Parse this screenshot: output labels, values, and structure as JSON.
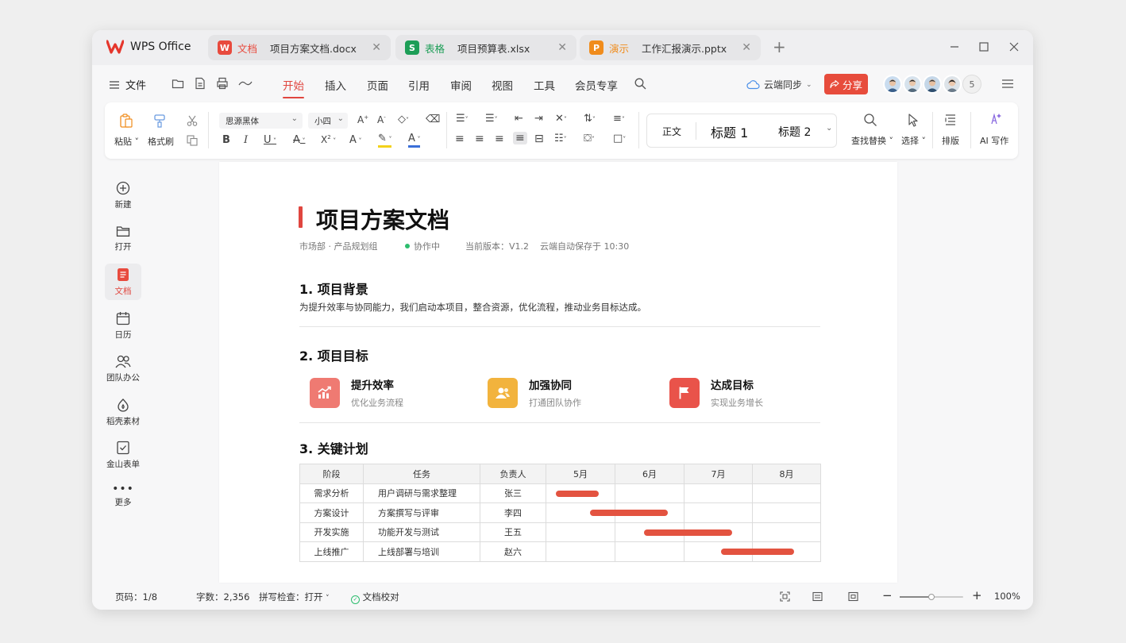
{
  "app": {
    "name": "WPS Office"
  },
  "tabs": [
    {
      "kind": "文档",
      "badge": "W",
      "color": "#e84a3d",
      "file": "项目方案文档.docx",
      "active": true
    },
    {
      "kind": "表格",
      "badge": "S",
      "color": "#1d9e57",
      "file": "项目预算表.xlsx"
    },
    {
      "kind": "演示",
      "badge": "P",
      "color": "#f08c1c",
      "file": "工作汇报演示.pptx"
    }
  ],
  "menu": {
    "file": "文件",
    "tabs": [
      "开始",
      "插入",
      "页面",
      "引用",
      "审阅",
      "视图",
      "工具",
      "会员专享"
    ],
    "active_index": 0,
    "cloud_sync": "云端同步",
    "share": "分享",
    "collaborator_count": "5"
  },
  "ribbon": {
    "paste": "粘贴",
    "format_painter": "格式刷",
    "font": "思源黑体",
    "font_size": "小四",
    "styles": [
      "正文",
      "标题 1",
      "标题 2"
    ],
    "find_replace": "查找替换",
    "select": "选择",
    "layout": "排版",
    "ai_write": "AI 写作"
  },
  "sidebar": [
    {
      "label": "新建",
      "icon": "plus-circle-icon"
    },
    {
      "label": "打开",
      "icon": "folder-icon"
    },
    {
      "label": "文档",
      "icon": "document-icon",
      "active": true
    },
    {
      "label": "日历",
      "icon": "calendar-icon"
    },
    {
      "label": "团队办公",
      "icon": "team-icon"
    },
    {
      "label": "稻壳素材",
      "icon": "material-icon"
    },
    {
      "label": "金山表单",
      "icon": "form-icon"
    },
    {
      "label": "更多",
      "icon": "more-icon"
    }
  ],
  "document": {
    "title": "项目方案文档",
    "dept": "市场部 · 产品规划组",
    "status": "协作中",
    "version": "当前版本：V1.2",
    "autosave": "云端自动保存于 10:30",
    "s1": {
      "title": "1. 项目背景",
      "text": "为提升效率与协同能力，我们启动本项目，整合资源，优化流程，推动业务目标达成。"
    },
    "s2": {
      "title": "2. 项目目标",
      "goals": [
        {
          "title": "提升效率",
          "subtitle": "优化业务流程",
          "color": "#ef7a72",
          "icon": "chart-up-icon"
        },
        {
          "title": "加强协同",
          "subtitle": "打通团队协作",
          "color": "#f2b33d",
          "icon": "people-icon"
        },
        {
          "title": "达成目标",
          "subtitle": "实现业务增长",
          "color": "#e9534a",
          "icon": "flag-icon"
        }
      ]
    },
    "s3": {
      "title": "3. 关键计划",
      "headers": [
        "阶段",
        "任务",
        "负责人",
        "5月",
        "6月",
        "7月",
        "8月"
      ],
      "rows": [
        {
          "stage": "需求分析",
          "task": "用户调研与需求整理",
          "owner": "张三",
          "start": 5.15,
          "end": 5.78
        },
        {
          "stage": "方案设计",
          "task": "方案撰写与评审",
          "owner": "李四",
          "start": 5.65,
          "end": 6.78
        },
        {
          "stage": "开发实施",
          "task": "功能开发与测试",
          "owner": "王五",
          "start": 6.43,
          "end": 7.72
        },
        {
          "stage": "上线推广",
          "task": "上线部署与培训",
          "owner": "赵六",
          "start": 7.55,
          "end": 8.62
        }
      ]
    }
  },
  "status_bar": {
    "page": "页码：1/8",
    "words": "字数：2,356",
    "spell": "拼写检查：打开",
    "proof": "文档校对",
    "zoom": "100%",
    "zoom_level": 0.5
  }
}
